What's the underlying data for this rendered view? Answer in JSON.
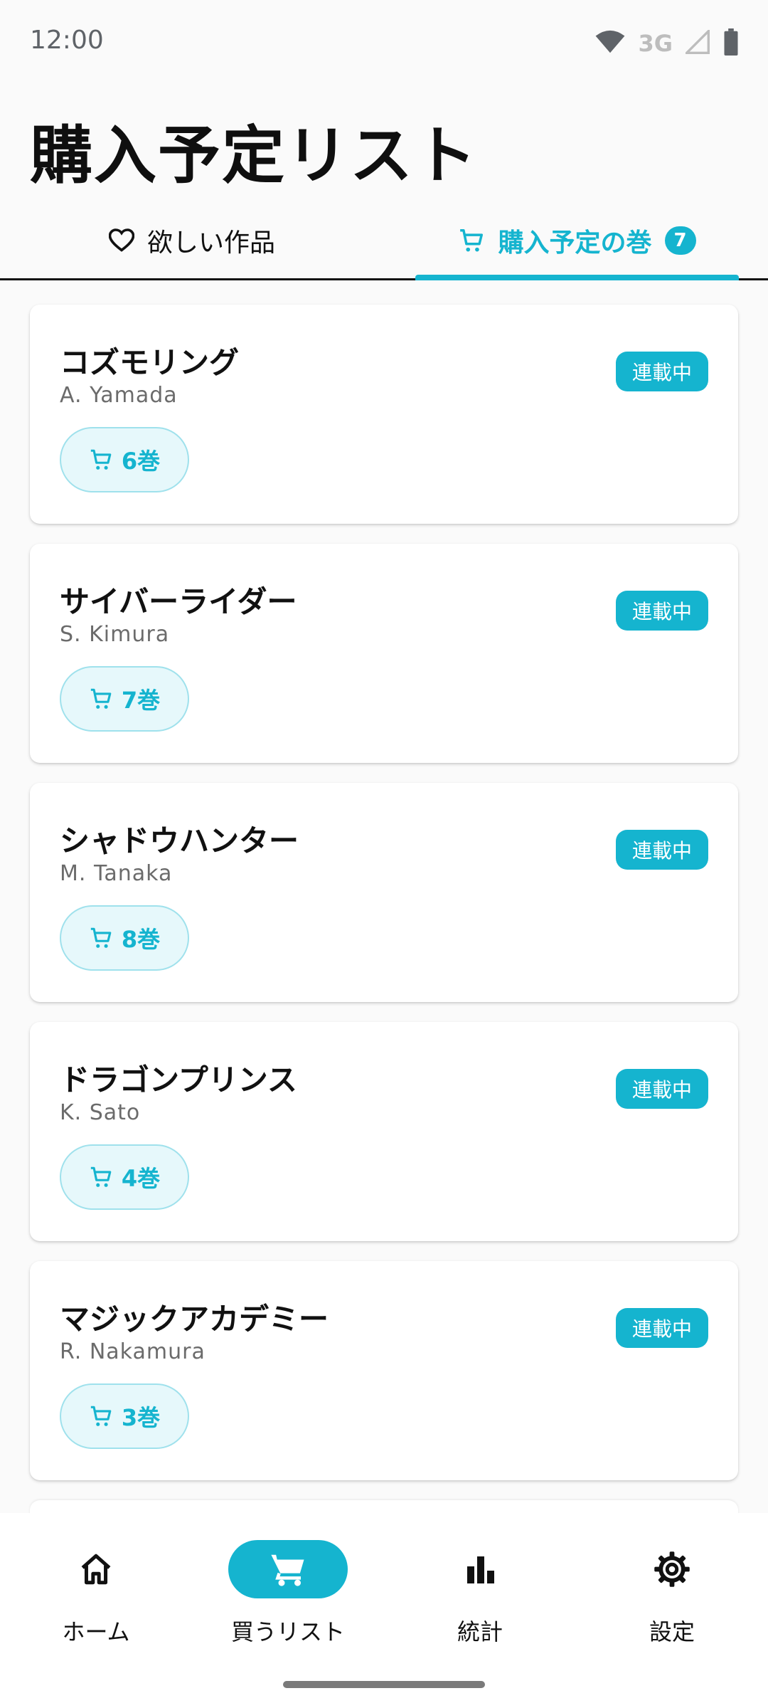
{
  "status_bar": {
    "time": "12:00",
    "network": "3G"
  },
  "page_title": "購入予定リスト",
  "tabs": [
    {
      "label": "欲しい作品",
      "icon": "heart-icon"
    },
    {
      "label": "購入予定の巻",
      "icon": "cart-icon",
      "badge": "7",
      "active": true
    }
  ],
  "items": [
    {
      "title": "コズモリング",
      "author": "A. Yamada",
      "status": "連載中",
      "volume": "6巻"
    },
    {
      "title": "サイバーライダー",
      "author": "S. Kimura",
      "status": "連載中",
      "volume": "7巻"
    },
    {
      "title": "シャドウハンター",
      "author": "M. Tanaka",
      "status": "連載中",
      "volume": "8巻"
    },
    {
      "title": "ドラゴンプリンス",
      "author": "K. Sato",
      "status": "連載中",
      "volume": "4巻"
    },
    {
      "title": "マジックアカデミー",
      "author": "R. Nakamura",
      "status": "連載中",
      "volume": "3巻"
    }
  ],
  "nav": [
    {
      "label": "ホーム",
      "icon": "home-icon"
    },
    {
      "label": "買うリスト",
      "icon": "cart-icon",
      "active": true
    },
    {
      "label": "統計",
      "icon": "bar-chart-icon"
    },
    {
      "label": "設定",
      "icon": "gear-icon"
    }
  ],
  "colors": {
    "accent": "#15b4cf",
    "background": "#fafafa",
    "card": "#ffffff",
    "pill_bg": "#e6f8fb"
  }
}
